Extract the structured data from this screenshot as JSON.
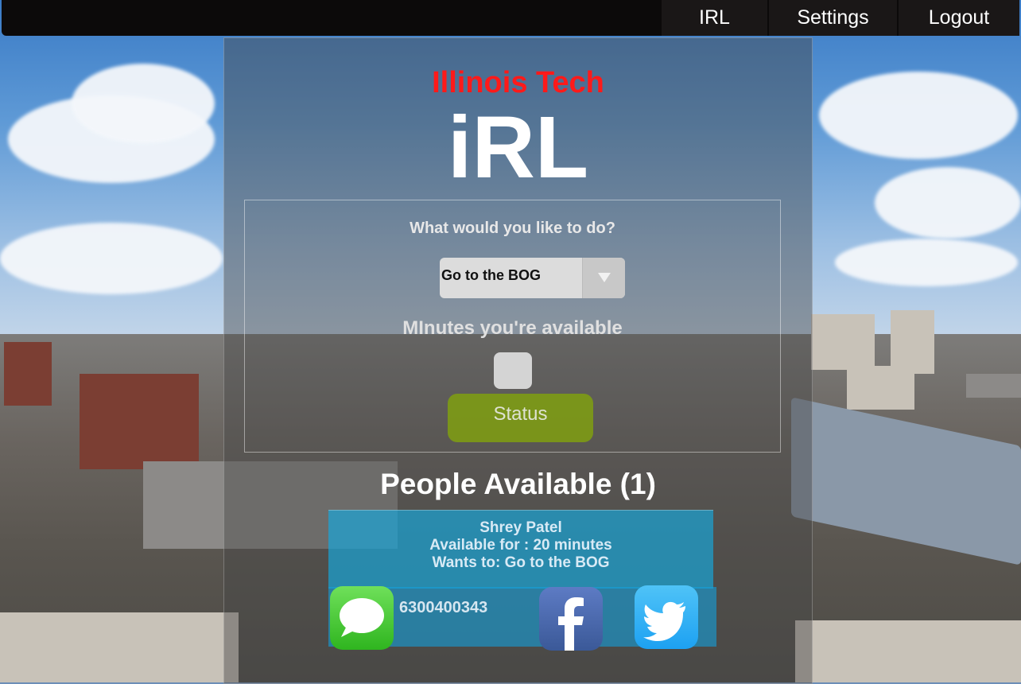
{
  "nav": {
    "items": [
      {
        "label": "IRL"
      },
      {
        "label": "Settings"
      },
      {
        "label": "Logout"
      }
    ]
  },
  "brand": {
    "subtitle": "Illinois Tech",
    "title": "iRL",
    "subtitle_color": "#ff1a1a"
  },
  "form": {
    "question": "What would you like to do?",
    "activity_selected": "Go to the BOG",
    "minutes_label": "MInutes you're available",
    "minutes_value": "",
    "status_button": "Status",
    "status_color": "#7d9a16"
  },
  "people": {
    "title": "People Available (1)",
    "list": [
      {
        "name": "Shrey Patel",
        "available": "Available for : 20 minutes",
        "wants": "Wants to: Go to the BOG",
        "phone": "6300400343"
      }
    ]
  },
  "icons": {
    "message": "message-icon",
    "facebook": "facebook-icon",
    "twitter": "twitter-icon",
    "dropdown": "chevron-down-icon"
  }
}
